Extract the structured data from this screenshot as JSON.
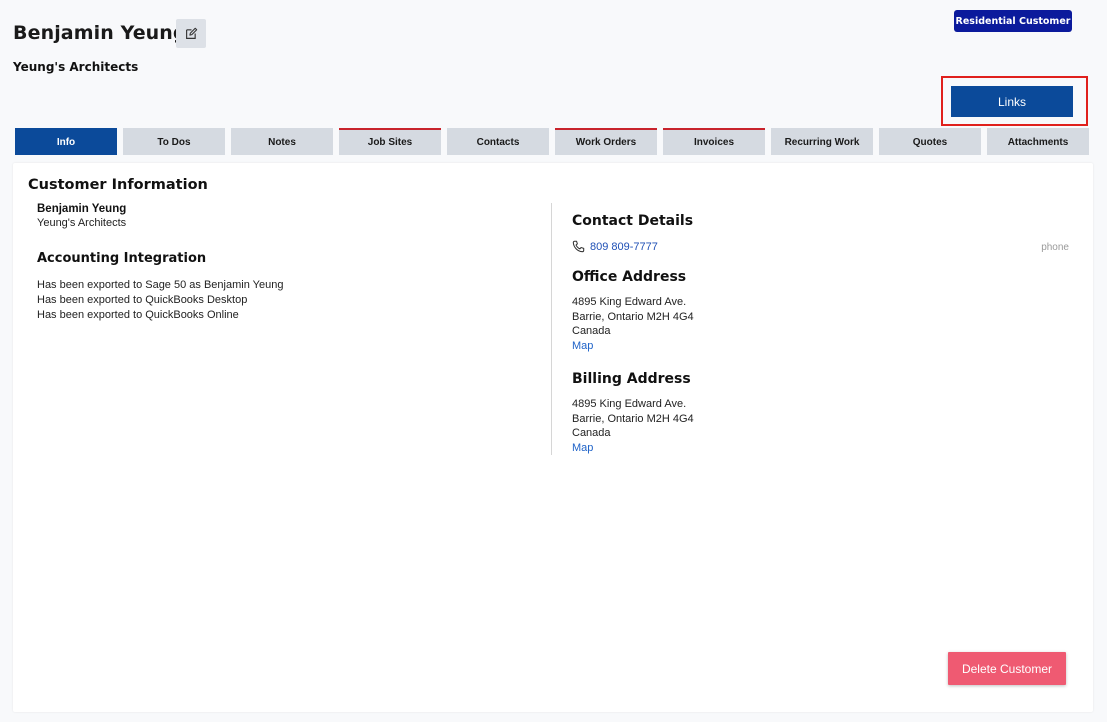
{
  "header": {
    "customer_name": "Benjamin Yeung",
    "company": "Yeung's Architects",
    "badge": "Residential Customer",
    "links_label": "Links",
    "edit_icon": "edit-icon"
  },
  "tabs": [
    {
      "label": "Info",
      "active": true,
      "flagged": false
    },
    {
      "label": "To Dos",
      "active": false,
      "flagged": false
    },
    {
      "label": "Notes",
      "active": false,
      "flagged": false
    },
    {
      "label": "Job Sites",
      "active": false,
      "flagged": true
    },
    {
      "label": "Contacts",
      "active": false,
      "flagged": false
    },
    {
      "label": "Work Orders",
      "active": false,
      "flagged": true
    },
    {
      "label": "Invoices",
      "active": false,
      "flagged": true
    },
    {
      "label": "Recurring Work",
      "active": false,
      "flagged": false
    },
    {
      "label": "Quotes",
      "active": false,
      "flagged": false
    },
    {
      "label": "Attachments",
      "active": false,
      "flagged": false
    }
  ],
  "info": {
    "title": "Customer Information",
    "name": "Benjamin Yeung",
    "company": "Yeung's Architects",
    "accounting_title": "Accounting Integration",
    "accounting_lines": [
      "Has been exported to Sage 50 as Benjamin Yeung",
      "Has been exported to QuickBooks Desktop",
      "Has been exported to QuickBooks Online"
    ]
  },
  "contact": {
    "title": "Contact Details",
    "phone": "809 809-7777",
    "phone_type": "phone",
    "phone_icon": "phone-icon"
  },
  "office_address": {
    "title": "Office Address",
    "line1": "4895 King Edward Ave.",
    "line2": "Barrie, Ontario M2H 4G4",
    "line3": "Canada",
    "map_label": "Map"
  },
  "billing_address": {
    "title": "Billing Address",
    "line1": "4895 King Edward Ave.",
    "line2": "Barrie, Ontario M2H 4G4",
    "line3": "Canada",
    "map_label": "Map"
  },
  "actions": {
    "delete_label": "Delete Customer"
  },
  "colors": {
    "primary": "#0b4a9a",
    "badge": "#0b1a9c",
    "tab_flag": "#c8232c",
    "delete": "#ef5a72",
    "link": "#1e62c8",
    "highlight": "#e0201c"
  }
}
